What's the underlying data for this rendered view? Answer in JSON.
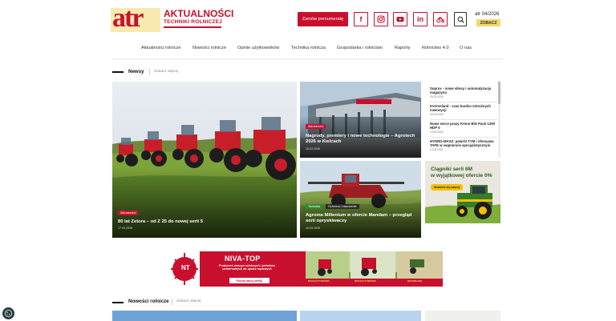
{
  "header": {
    "logo_short": "atr",
    "logo_line1": "AKTUALNOŚCI",
    "logo_line2": "TECHNIKI ROLNICZEJ",
    "subscribe_label": "Zamów prenumeratę",
    "social": [
      {
        "icon": "facebook-icon",
        "glyph": "f"
      },
      {
        "icon": "instagram-icon",
        "glyph": ""
      },
      {
        "icon": "youtube-icon",
        "glyph": ""
      },
      {
        "icon": "linkedin-icon",
        "glyph": "in"
      },
      {
        "icon": "tractor-icon",
        "glyph": ""
      }
    ],
    "issue_label": "atr 04/2026",
    "issue_button": "ZOBACZ",
    "accent": "#c8102e",
    "highlight": "#f3d86b"
  },
  "nav": {
    "items": [
      "Aktualności rolnicze",
      "Nowości rolnicze",
      "Opinie użytkowników",
      "Technika rolnicza",
      "Gospodarka i rolnictwo",
      "Raporty",
      "Rolnictwo 4.0",
      "O nas"
    ]
  },
  "newsy": {
    "title": "Newsy",
    "more": "Zobacz więcej",
    "main": {
      "badge": "Aktualności",
      "title": "80 lat Zetora – od Z 25 do nowej serii 5",
      "date": "17.03.2026"
    },
    "top_right": {
      "badge": "Aktualności",
      "title": "Nagrody, premiery i nowe technologie – Agrotech 2026 w Kielcach",
      "date": "16.03.2026"
    },
    "bottom_right": {
      "badges": [
        "Technika",
        "Ochrona i nawożenie"
      ],
      "title": "Agroma Millenium w ofercie Mandam – przegląd serii opryskiwaczy",
      "date": "16.03.2026"
    },
    "list": [
      {
        "title": "Suprox - nowe siłosy i automatyzacja magazynu",
        "date": "15.03.2026"
      },
      {
        "title": "Kverneland - czas bardzo ostrożnych inwestycji",
        "date": "15.03.2026"
      },
      {
        "title": "Nowe serce prasy Krone BiG Pack 1290 HDP II",
        "date": "14.03.2026"
      },
      {
        "title": "HYDRO-MASZ: powrót TYM i ofensywa TAFE w segmencie specjalistycznym",
        "date": "14.03.2026"
      }
    ]
  },
  "ad_side": {
    "line1": "Ciągniki serii 6M",
    "line2": "w wyjątkowej ofercie 0%",
    "button": "Dowiedz się więcej"
  },
  "banner": {
    "brand": "NIVA-TOP",
    "logo": "NT",
    "subtitle": "Producent maszyn rolniczych i pielników uniwersalnych do upraw rzędowych",
    "button": "Poznaj naszą ofertę!",
    "labels": [
      "NIVAKULTYWATOR",
      "NIVAKULTYWATOR",
      "NIVAPIELNIK"
    ]
  },
  "nowosci": {
    "title": "Nowości rolnicze",
    "more": "Zobacz więcej"
  }
}
